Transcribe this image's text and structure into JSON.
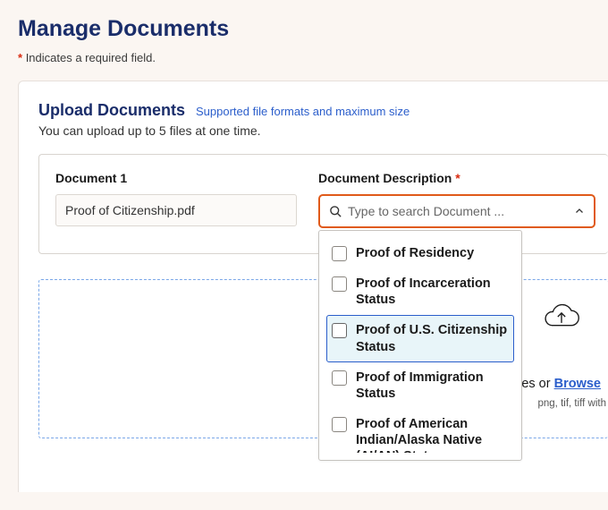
{
  "page": {
    "title": "Manage Documents",
    "required_note": "Indicates a required field."
  },
  "upload": {
    "title": "Upload Documents",
    "formats_link": "Supported file formats and maximum size",
    "subtitle": "You can upload up to 5 files at one time."
  },
  "doc1": {
    "label": "Document 1",
    "filename": "Proof of Citizenship.pdf"
  },
  "desc": {
    "label": "Document Description",
    "placeholder": "Type to search Document ..."
  },
  "options": {
    "o0": "Proof of Residency",
    "o1": "Proof of Incarceration Status",
    "o2": "Proof of U.S. Citizenship Status",
    "o3": "Proof of Immigration Status",
    "o4": "Proof of American Indian/Alaska Native (AI/AN) Status"
  },
  "dropzone": {
    "pre_text": "es or  ",
    "browse": "Browse",
    "formats": "png, tif, tiff with"
  }
}
